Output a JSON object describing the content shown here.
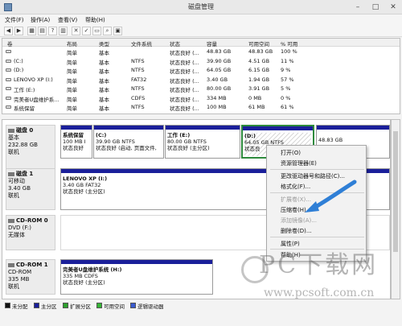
{
  "window": {
    "title": "磁盘管理"
  },
  "menu": [
    "文件(F)",
    "操作(A)",
    "查看(V)",
    "帮助(H)"
  ],
  "volume_table": {
    "columns": [
      "卷",
      "布局",
      "类型",
      "文件系统",
      "状态",
      "容量",
      "可用空间",
      "% 可用"
    ],
    "rows": [
      [
        "",
        "简单",
        "基本",
        "",
        "状态良好 (...",
        "48.83 GB",
        "48.83 GB",
        "100 %"
      ],
      [
        "(C:)",
        "简单",
        "基本",
        "NTFS",
        "状态良好 (...",
        "39.90 GB",
        "4.51 GB",
        "11 %"
      ],
      [
        "(D:)",
        "简单",
        "基本",
        "NTFS",
        "状态良好 (...",
        "64.05 GB",
        "6.15 GB",
        "9 %"
      ],
      [
        "LENOVO XP (I:)",
        "简单",
        "基本",
        "FAT32",
        "状态良好 (...",
        "3.40 GB",
        "1.94 GB",
        "57 %"
      ],
      [
        "工作 (E:)",
        "简单",
        "基本",
        "NTFS",
        "状态良好 (...",
        "80.00 GB",
        "3.91 GB",
        "5 %"
      ],
      [
        "完美者U盘维护系...",
        "简单",
        "基本",
        "CDFS",
        "状态良好 (...",
        "334 MB",
        "0 MB",
        "0 %"
      ],
      [
        "系统保留",
        "简单",
        "基本",
        "NTFS",
        "状态良好 (...",
        "100 MB",
        "61 MB",
        "61 %"
      ]
    ]
  },
  "disks": [
    {
      "name": "磁盘 0",
      "type": "基本",
      "size": "232.88 GB",
      "status": "联机",
      "partitions": [
        {
          "name": "系统保留",
          "line1": "100 MB I",
          "line2": "状态良好"
        },
        {
          "name": "(C:)",
          "line1": "39.90 GB NTFS",
          "line2": "状态良好 (启动, 页面文件,"
        },
        {
          "name": "工作 (E:)",
          "line1": "80.00 GB NTFS",
          "line2": "状态良好 (主分区)"
        },
        {
          "name": "(D:)",
          "line1": "64.05 GB NTFS",
          "line2": "状态良"
        },
        {
          "name": "",
          "line1": "48.83 GB",
          "line2": ""
        }
      ]
    },
    {
      "name": "磁盘 1",
      "type": "可移动",
      "size": "3.40 GB",
      "status": "联机",
      "partitions": [
        {
          "name": "LENOVO XP (I:)",
          "line1": "3.40 GB FAT32",
          "line2": "状态良好 (主分区)"
        }
      ]
    },
    {
      "name": "CD-ROM 0",
      "type": "DVD (F:)",
      "size": "",
      "status": "无媒体",
      "partitions": []
    },
    {
      "name": "CD-ROM 1",
      "type": "CD-ROM",
      "size": "335 MB",
      "status": "联机",
      "partitions": [
        {
          "name": "完美者U盘维护系统 (H:)",
          "line1": "335 MB CDFS",
          "line2": "状态良好 (主分区)"
        }
      ]
    }
  ],
  "context_menu": {
    "items": [
      {
        "label": "打开(O)",
        "enabled": true
      },
      {
        "label": "资源管理器(E)",
        "enabled": true
      },
      {
        "label": "更改驱动器号和路径(C)...",
        "enabled": true
      },
      {
        "label": "格式化(F)...",
        "enabled": true
      },
      {
        "label": "扩展卷(X)...",
        "enabled": false
      },
      {
        "label": "压缩卷(H)...",
        "enabled": true
      },
      {
        "label": "添加镜像(A)...",
        "enabled": false
      },
      {
        "label": "删除卷(D)...",
        "enabled": true
      },
      {
        "label": "属性(P)",
        "enabled": true
      },
      {
        "label": "帮助(H)",
        "enabled": true
      }
    ]
  },
  "legend": [
    {
      "label": "未分配",
      "color": "#111111"
    },
    {
      "label": "主分区",
      "color": "#1a1f9a"
    },
    {
      "label": "扩展分区",
      "color": "#2ea12e"
    },
    {
      "label": "可用空间",
      "color": "#35b535"
    },
    {
      "label": "逻辑驱动器",
      "color": "#3a5bd0"
    }
  ],
  "watermark": {
    "big": "PC下载网",
    "small": "www.pcsoft.com.cn"
  }
}
